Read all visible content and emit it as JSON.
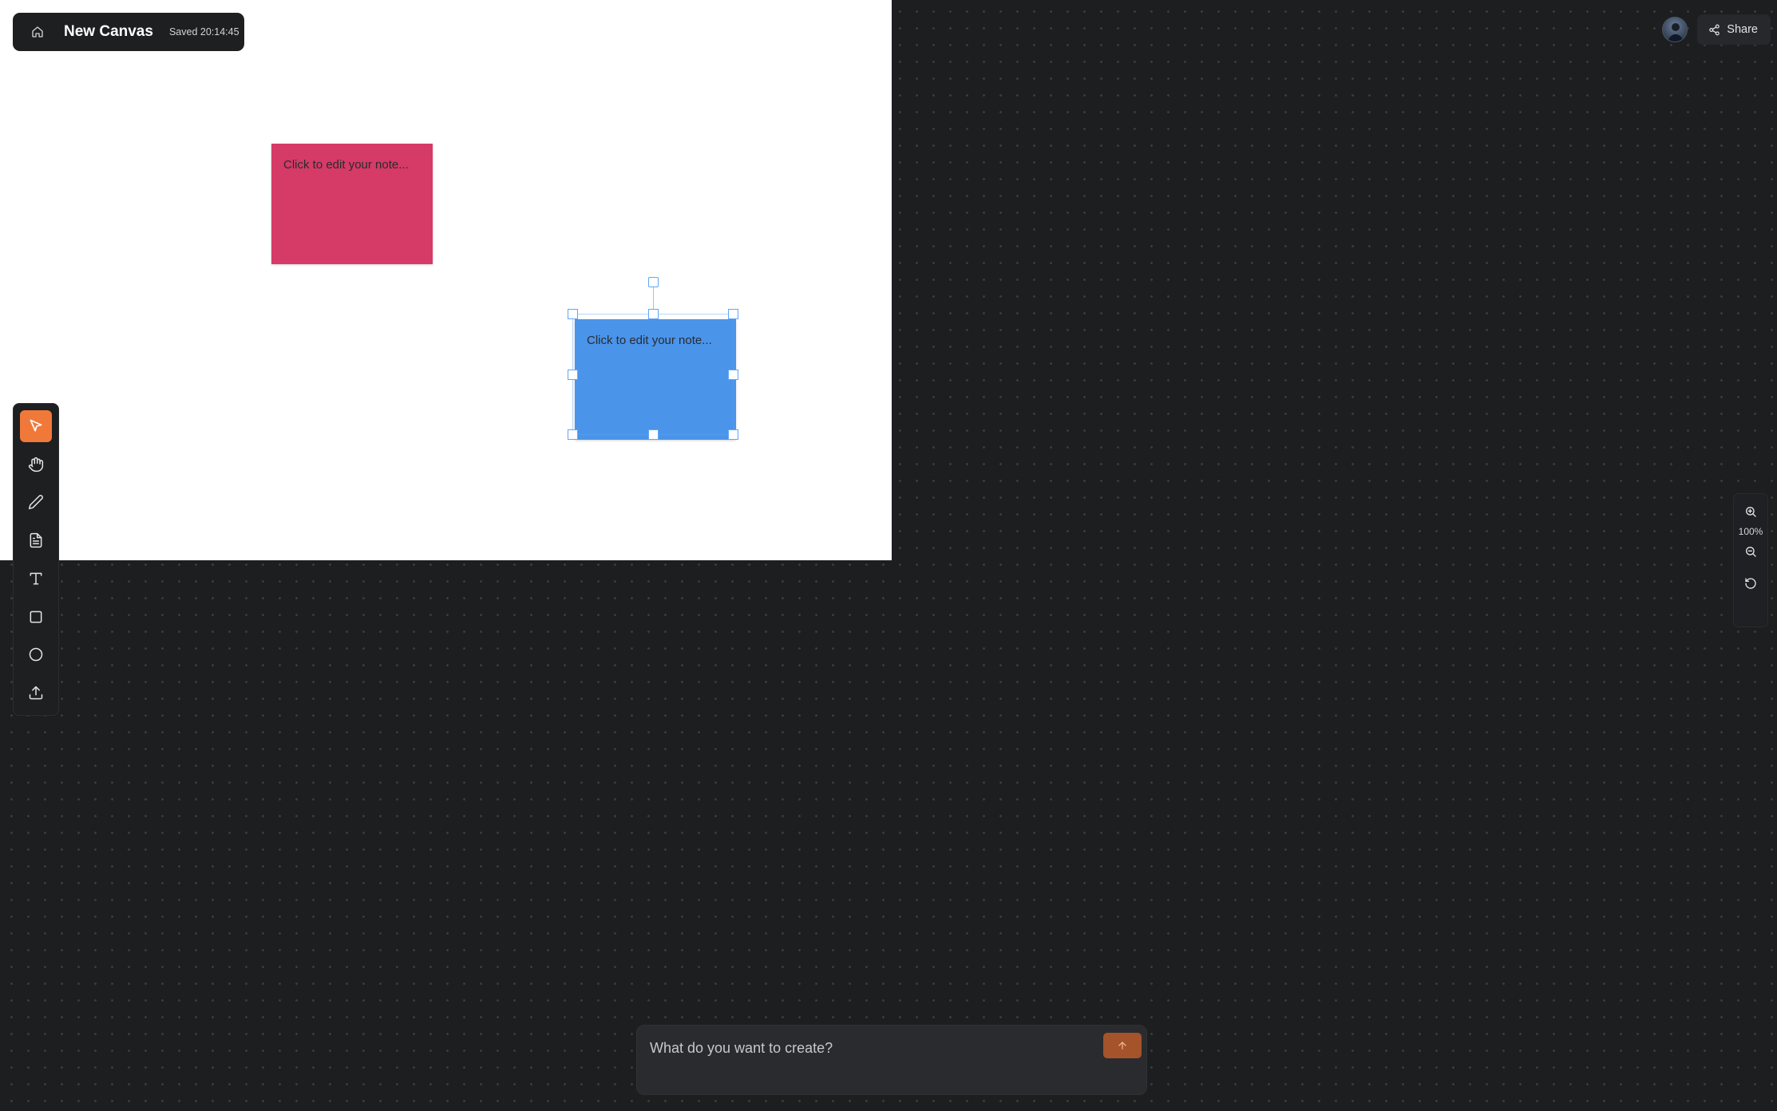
{
  "header": {
    "home_icon": "home-icon",
    "title": "New Canvas",
    "saved_status": "Saved 20:14:45"
  },
  "notes": [
    {
      "text": "Click to edit your note...",
      "color": "#d63a66",
      "selected": false
    },
    {
      "text": "Click to edit your note...",
      "color": "#4a94ea",
      "selected": true
    }
  ],
  "toolbar": {
    "active_tool": "select",
    "tools": [
      {
        "name": "select",
        "icon": "cursor-icon"
      },
      {
        "name": "hand",
        "icon": "hand-icon"
      },
      {
        "name": "pen",
        "icon": "pencil-icon"
      },
      {
        "name": "note",
        "icon": "note-icon"
      },
      {
        "name": "text",
        "icon": "text-icon"
      },
      {
        "name": "rectangle",
        "icon": "square-icon"
      },
      {
        "name": "ellipse",
        "icon": "circle-icon"
      },
      {
        "name": "upload",
        "icon": "upload-icon"
      }
    ]
  },
  "top_right": {
    "share_label": "Share",
    "share_icon": "share-icon",
    "avatar": "user-avatar"
  },
  "zoom": {
    "level": "100%",
    "zoom_in_icon": "zoom-in-icon",
    "zoom_out_icon": "zoom-out-icon",
    "reset_icon": "reset-icon"
  },
  "prompt": {
    "placeholder": "What do you want to create?",
    "send_icon": "arrow-up-icon"
  },
  "colors": {
    "accent": "#f0793a",
    "send_button": "#a4532a",
    "selection": "#60a5fa",
    "background": "#1d1e20"
  }
}
